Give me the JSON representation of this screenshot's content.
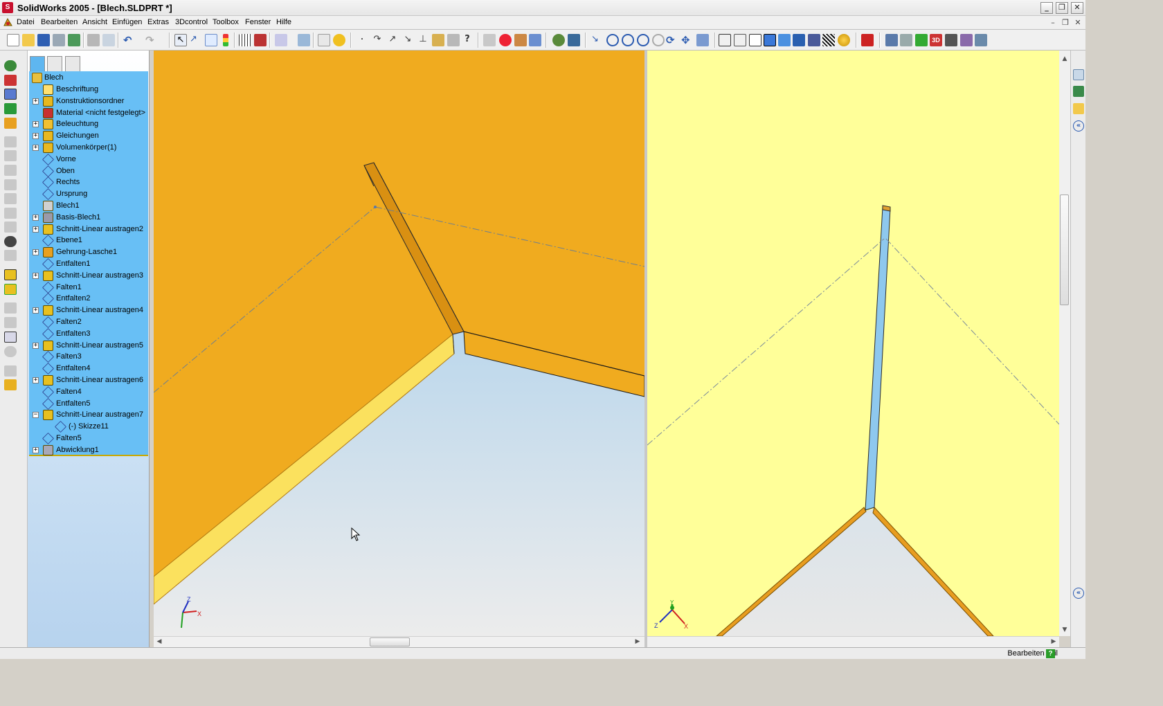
{
  "window": {
    "title": "SolidWorks 2005 - [Blech.SLDPRT *]",
    "app_icon": "solidworks-icon",
    "controls": [
      "minimize-icon",
      "restore-icon",
      "close-icon"
    ]
  },
  "menubar": {
    "items": [
      "Datei",
      "Bearbeiten",
      "Ansicht",
      "Einfügen",
      "Extras",
      "3Dcontrol",
      "Toolbox",
      "Fenster",
      "Hilfe"
    ]
  },
  "toolbar": {
    "groups": [
      [
        "new-icon",
        "open-icon",
        "save-icon",
        "print-setup-icon",
        "options-icon"
      ],
      [
        "print-icon",
        "print-preview-icon"
      ],
      [
        "undo-icon",
        "redo-icon"
      ],
      [
        "select-icon",
        "smart-select-icon",
        "sketch-icon",
        "rebuild-icon"
      ],
      [
        "grid-icon",
        "brick-icon"
      ],
      [
        "view-orient-icon",
        "measure-icon"
      ],
      [
        "properties-icon",
        "help-icon"
      ],
      [
        "point-icon",
        "arc-icon",
        "line-icon",
        "arrow-icon",
        "perpendicular-icon",
        "bend-icon",
        "sheetmetal-icon",
        "whats-this-icon"
      ],
      [
        "zoom-fit-icon",
        "stop-icon",
        "report-icon",
        "list-icon"
      ],
      [
        "gear-icon",
        "tools-icon"
      ],
      [
        "pointer-icon",
        "zoom-to-fit-icon",
        "zoom-area-icon",
        "zoom-in-out-icon",
        "zoom-selection-icon",
        "rotate-icon",
        "pan-icon",
        "view-cube-icon"
      ],
      [
        "wireframe-icon",
        "hidden-lines-visible-icon",
        "hidden-lines-removed-icon",
        "shaded-edges-icon",
        "shaded-icon",
        "shadow-icon",
        "section-view-icon",
        "curvature-icon",
        "realview-icon"
      ],
      [
        "record-icon"
      ],
      [
        "camera-icon",
        "scene-icon",
        "light-icon",
        "3d-icon",
        "materials-icon",
        "toolbox-icon",
        "rip-icon"
      ]
    ]
  },
  "feature_manager": {
    "tabs": [
      "feature-tree-tab",
      "property-manager-tab",
      "configuration-manager-tab"
    ],
    "root": "Blech",
    "items": [
      {
        "label": "Beschriftung",
        "icon": "annotations-icon",
        "expandable": false,
        "indent": 1
      },
      {
        "label": "Konstruktionsordner",
        "icon": "design-folder-icon",
        "expandable": true,
        "expander": "+",
        "indent": 1
      },
      {
        "label": "Material <nicht festgelegt>",
        "icon": "material-icon",
        "expandable": false,
        "indent": 1
      },
      {
        "label": "Beleuchtung",
        "icon": "lighting-icon",
        "expandable": true,
        "expander": "+",
        "indent": 1
      },
      {
        "label": "Gleichungen",
        "icon": "equations-icon",
        "expandable": true,
        "expander": "+",
        "indent": 1
      },
      {
        "label": "Volumenkörper(1)",
        "icon": "solid-bodies-icon",
        "expandable": true,
        "expander": "+",
        "indent": 1
      },
      {
        "label": "Vorne",
        "icon": "plane-icon",
        "expandable": false,
        "indent": 1
      },
      {
        "label": "Oben",
        "icon": "plane-icon",
        "expandable": false,
        "indent": 1
      },
      {
        "label": "Rechts",
        "icon": "plane-icon",
        "expandable": false,
        "indent": 1
      },
      {
        "label": "Ursprung",
        "icon": "origin-icon",
        "expandable": false,
        "indent": 1
      },
      {
        "label": "Blech1",
        "icon": "sheetmetal-feature-icon",
        "expandable": false,
        "indent": 1
      },
      {
        "label": "Basis-Blech1",
        "icon": "base-flange-icon",
        "expandable": true,
        "expander": "+",
        "indent": 1
      },
      {
        "label": "Schnitt-Linear austragen2",
        "icon": "cut-extrude-icon",
        "expandable": true,
        "expander": "+",
        "indent": 1
      },
      {
        "label": "Ebene1",
        "icon": "plane-icon",
        "expandable": false,
        "indent": 1
      },
      {
        "label": "Gehrung-Lasche1",
        "icon": "miter-flange-icon",
        "expandable": true,
        "expander": "+",
        "indent": 1
      },
      {
        "label": "Entfalten1",
        "icon": "unfold-icon",
        "expandable": false,
        "indent": 1
      },
      {
        "label": "Schnitt-Linear austragen3",
        "icon": "cut-extrude-icon",
        "expandable": true,
        "expander": "+",
        "indent": 1
      },
      {
        "label": "Falten1",
        "icon": "fold-icon",
        "expandable": false,
        "indent": 1
      },
      {
        "label": "Entfalten2",
        "icon": "unfold-icon",
        "expandable": false,
        "indent": 1
      },
      {
        "label": "Schnitt-Linear austragen4",
        "icon": "cut-extrude-icon",
        "expandable": true,
        "expander": "+",
        "indent": 1
      },
      {
        "label": "Falten2",
        "icon": "fold-icon",
        "expandable": false,
        "indent": 1
      },
      {
        "label": "Entfalten3",
        "icon": "unfold-icon",
        "expandable": false,
        "indent": 1
      },
      {
        "label": "Schnitt-Linear austragen5",
        "icon": "cut-extrude-icon",
        "expandable": true,
        "expander": "+",
        "indent": 1
      },
      {
        "label": "Falten3",
        "icon": "fold-icon",
        "expandable": false,
        "indent": 1
      },
      {
        "label": "Entfalten4",
        "icon": "unfold-icon",
        "expandable": false,
        "indent": 1
      },
      {
        "label": "Schnitt-Linear austragen6",
        "icon": "cut-extrude-icon",
        "expandable": true,
        "expander": "+",
        "indent": 1
      },
      {
        "label": "Falten4",
        "icon": "fold-icon",
        "expandable": false,
        "indent": 1
      },
      {
        "label": "Entfalten5",
        "icon": "unfold-icon",
        "expandable": false,
        "indent": 1
      },
      {
        "label": "Schnitt-Linear austragen7",
        "icon": "cut-extrude-icon",
        "expandable": true,
        "expander": "−",
        "indent": 1
      },
      {
        "label": "(-) Skizze11",
        "icon": "sketch-icon",
        "expandable": false,
        "indent": 2
      },
      {
        "label": "Falten5",
        "icon": "fold-icon",
        "expandable": false,
        "indent": 1
      },
      {
        "label": "Abwicklung1",
        "icon": "flat-pattern-icon",
        "expandable": true,
        "expander": "+",
        "indent": 1
      }
    ]
  },
  "left_toolbar": {
    "icons": [
      "sketch-tools-icon",
      "dimension-icon",
      "features-icon",
      "sheetmetal-tools-icon",
      "reference-geometry-icon",
      "extrude-icon",
      "revolve-icon",
      "sweep-icon",
      "loft-icon",
      "fillet-icon",
      "chamfer-icon",
      "shell-icon",
      "rib-icon",
      "wrap-icon",
      "dome-icon",
      "cut-icon",
      "hole-icon",
      "base-flange-tool-icon",
      "edge-flange-icon",
      "miter-flange-tool-icon",
      "hem-icon",
      "jog-icon",
      "flatten-icon",
      "forming-tool-icon"
    ]
  },
  "taskpane": {
    "icons": [
      "home-icon",
      "library-icon",
      "file-explorer-icon",
      "collapse-icon"
    ],
    "bottom_icon": "expand-icon"
  },
  "statusbar": {
    "text": "Bearbeiten Teil",
    "help_label": "?"
  },
  "colors": {
    "part_orange": "#f0ab1f",
    "part_face_light": "#fbe15e",
    "part_edge": "#c07810",
    "tree_background": "#68bff5",
    "right_viewport_bg": "#ffff99",
    "viewport_gradient_top": "#a8d2f0",
    "viewport_gradient_bottom": "#e8e8e8",
    "thin_blue_face": "#8ec8ee"
  },
  "axis_labels": {
    "x": "X",
    "y": "Y",
    "z": "Z"
  }
}
